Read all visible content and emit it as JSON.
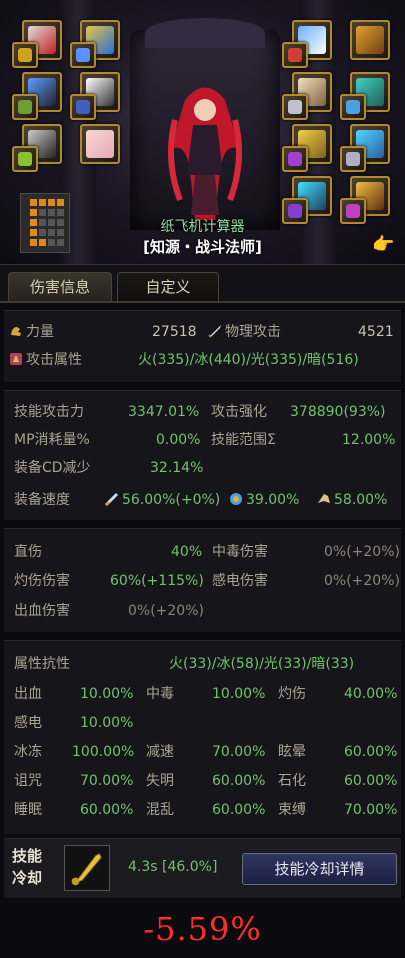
{
  "header": {
    "calculator_name": "纸飞机计算器",
    "character_line": "[知源・战斗法师]",
    "hand_icon": "pointing-hand-icon"
  },
  "tabs": [
    {
      "label": "伤害信息",
      "active": true
    },
    {
      "label": "自定义",
      "active": false
    }
  ],
  "basic": {
    "strength_label": "力量",
    "strength_value": "27518",
    "phys_atk_label": "物理攻击",
    "phys_atk_value": "4521",
    "element_label": "攻击属性",
    "element_value": "火(335)/冰(440)/光(335)/暗(516)"
  },
  "skill": {
    "skill_atk_label": "技能攻击力",
    "skill_atk_value": "3347.01%",
    "atk_enh_label": "攻击强化",
    "atk_enh_value": "378890(93%)",
    "mp_label": "MP消耗量%",
    "mp_value": "0.00%",
    "range_label": "技能范围Σ",
    "range_value": "12.00%",
    "cdr_label": "装备CD减少",
    "cdr_value": "32.14%",
    "speed_label": "装备速度",
    "speed_atk": "56.00%(+0%)",
    "speed_cast": "39.00%",
    "speed_move": "58.00%"
  },
  "damage": {
    "direct_label": "直伤",
    "direct_value": "40%",
    "poison_label": "中毒伤害",
    "poison_value": "0%(+20%)",
    "burn_label": "灼伤伤害",
    "burn_value": "60%(+115%)",
    "shock_label": "感电伤害",
    "shock_value": "0%(+20%)",
    "bleed_label": "出血伤害",
    "bleed_value": "0%(+20%)"
  },
  "resist": {
    "title": "属性抗性",
    "elem_value": "火(33)/冰(58)/光(33)/暗(33)",
    "rows": [
      [
        {
          "k": "出血",
          "v": "10.00%"
        },
        {
          "k": "中毒",
          "v": "10.00%"
        },
        {
          "k": "灼伤",
          "v": "40.00%"
        }
      ],
      [
        {
          "k": "感电",
          "v": "10.00%"
        }
      ],
      [
        {
          "k": "冰冻",
          "v": "100.00%"
        },
        {
          "k": "减速",
          "v": "70.00%"
        },
        {
          "k": "眩晕",
          "v": "60.00%"
        }
      ],
      [
        {
          "k": "诅咒",
          "v": "70.00%"
        },
        {
          "k": "失明",
          "v": "60.00%"
        },
        {
          "k": "石化",
          "v": "60.00%"
        }
      ],
      [
        {
          "k": "睡眠",
          "v": "60.00%"
        },
        {
          "k": "混乱",
          "v": "60.00%"
        },
        {
          "k": "束缚",
          "v": "70.00%"
        }
      ]
    ]
  },
  "cooldown": {
    "label": "技能冷却",
    "value": "4.3s [46.0%]",
    "detail_button": "技能冷却详情",
    "icon": "golden-horn-icon"
  },
  "result": "-5.59%",
  "colors": {
    "positive": "#6fc46a",
    "negative": "#ff2d2d",
    "label": "#a9a394"
  }
}
